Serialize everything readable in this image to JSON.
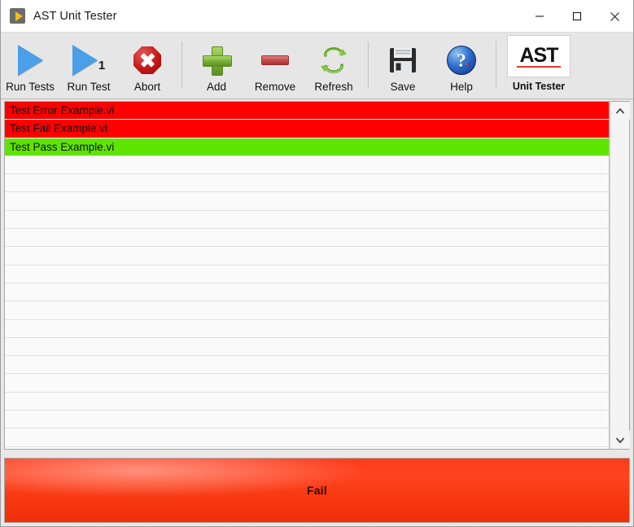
{
  "window": {
    "title": "AST Unit Tester",
    "icon": "labview-run-arrow-icon",
    "controls": {
      "minimize": "minimize-button",
      "maximize": "maximize-button",
      "close": "close-button"
    }
  },
  "toolbar": {
    "buttons": [
      {
        "id": "run-tests",
        "label": "Run Tests",
        "icon": "play-triangle-icon",
        "badge": ""
      },
      {
        "id": "run-test",
        "label": "Run Test",
        "icon": "play-triangle-icon",
        "badge": "1"
      },
      {
        "id": "abort",
        "label": "Abort",
        "icon": "stop-octagon-icon",
        "badge": ""
      },
      {
        "id": "add",
        "label": "Add",
        "icon": "plus-icon",
        "badge": ""
      },
      {
        "id": "remove",
        "label": "Remove",
        "icon": "minus-icon",
        "badge": ""
      },
      {
        "id": "refresh",
        "label": "Refresh",
        "icon": "refresh-arrows-icon",
        "badge": ""
      },
      {
        "id": "save",
        "label": "Save",
        "icon": "floppy-disk-icon",
        "badge": ""
      },
      {
        "id": "help",
        "label": "Help",
        "icon": "question-mark-icon",
        "badge": "?"
      }
    ],
    "brand": {
      "logo_text": "AST",
      "logo_subtitle": "Unit Tester",
      "accent_color": "#e03a2f"
    }
  },
  "test_list": {
    "rows": [
      {
        "name": "Test Error Example.vi",
        "state": "error"
      },
      {
        "name": "Test Fail Example.vi",
        "state": "fail"
      },
      {
        "name": "Test Pass Example.vi",
        "state": "pass"
      }
    ],
    "empty_row_count": 16,
    "scrollbar": {
      "up_arrow": "scroll-up-arrow",
      "down_arrow": "scroll-down-arrow"
    }
  },
  "status": {
    "text": "Fail",
    "state": "fail",
    "color": "#ff3b19"
  },
  "colors": {
    "pass": "#5fe400",
    "fail": "#ff0000",
    "error": "#ff0000",
    "toolbar_bg": "#e6e6e6",
    "list_bg": "#fafafa"
  }
}
